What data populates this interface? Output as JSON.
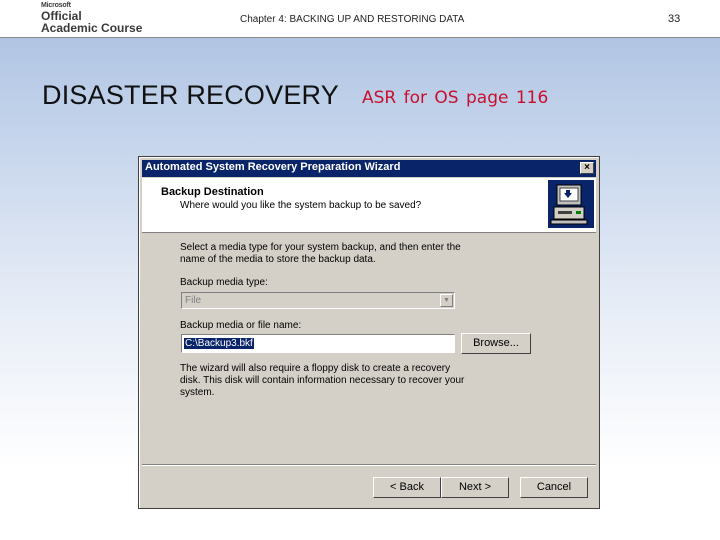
{
  "slide": {
    "logo_microsoft": "Microsoft",
    "logo_official": "Official",
    "logo_course": "Academic Course",
    "chapter": "Chapter 4: BACKING UP AND RESTORING DATA",
    "page_number": "33",
    "title": "DISASTER RECOVERY",
    "subtitle": "ASR for OS  page  116",
    "subtitle_color": "#c8102e"
  },
  "dialog": {
    "title": "Automated System Recovery Preparation Wizard",
    "close_glyph": "×",
    "section_title": "Backup Destination",
    "section_subtitle": "Where would you like the system backup to be saved?",
    "description": "Select a media type for your system backup, and then enter the name of the media to store the backup data.",
    "media_type_label": "Backup media type:",
    "media_type_value": "File",
    "file_name_label": "Backup media or file name:",
    "file_name_value": "C:\\Backup3.bkf",
    "browse_label": "Browse...",
    "note": "The wizard will also require a floppy disk to create a recovery disk. This disk will contain information necessary to recover your system.",
    "back_label": "< Back",
    "next_label": "Next >",
    "cancel_label": "Cancel",
    "icon": "backup-computer-icon",
    "titlebar_color": "#0a246a"
  }
}
